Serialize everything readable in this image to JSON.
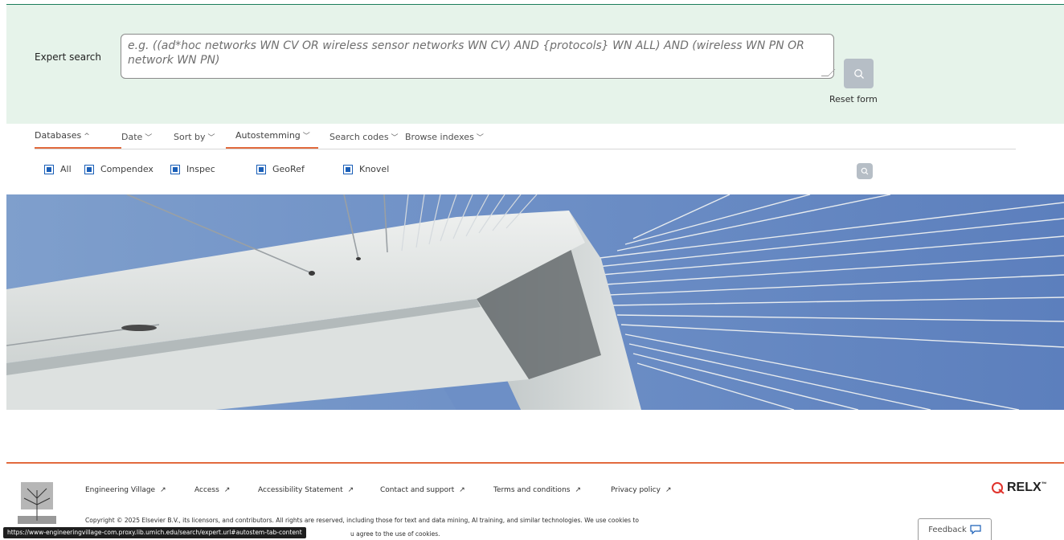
{
  "expert_search": {
    "label": "Expert search",
    "placeholder": "e.g. ((ad*hoc networks WN CV OR wireless sensor networks WN CV) AND {protocols} WN ALL) AND (wireless WN PN OR network WN PN)",
    "search_icon": "search-icon",
    "reset_label": "Reset form"
  },
  "tabs": [
    {
      "label": "Databases",
      "chevron": "^"
    },
    {
      "label": "Date",
      "chevron": "﹀"
    },
    {
      "label": "Sort by",
      "chevron": "﹀"
    },
    {
      "label": "Autostemming",
      "chevron": "﹀"
    },
    {
      "label": "Search codes",
      "chevron": "﹀"
    },
    {
      "label": "Browse indexes",
      "chevron": "﹀"
    }
  ],
  "databases": [
    {
      "label": "All",
      "checked": true
    },
    {
      "label": "Compendex",
      "checked": true
    },
    {
      "label": "Inspec",
      "checked": true
    },
    {
      "label": "GeoRef",
      "checked": true
    },
    {
      "label": "Knovel",
      "checked": true
    }
  ],
  "footer": {
    "links": [
      {
        "label": "Engineering Village",
        "arrow": "↗"
      },
      {
        "label": "Access",
        "arrow": "↗"
      },
      {
        "label": "Accessibility Statement",
        "arrow": "↗"
      },
      {
        "label": "Contact and support",
        "arrow": "↗"
      },
      {
        "label": "Terms and conditions",
        "arrow": "↗"
      },
      {
        "label": "Privacy policy",
        "arrow": "↗"
      }
    ],
    "copyright_line1": "Copyright © 2025 Elsevier B.V., its licensors, and contributors. All rights are reserved, including those for text and data mining, AI training, and similar technologies. We use cookies to",
    "copyright_line2": "u agree to the use of cookies.",
    "relx_label": "RELX",
    "relx_tm": "™",
    "feedback_label": "Feedback"
  },
  "status_bar_url": "https://www-engineeringvillage-com.proxy.lib.umich.edu/search/expert.url#autostem-tab-content",
  "colors": {
    "panel_bg": "#e6f3ea",
    "accent": "#e26a3e",
    "checkbox": "#1a5fb8",
    "button_gray": "#b6bec6",
    "relx_red": "#e0322b"
  }
}
